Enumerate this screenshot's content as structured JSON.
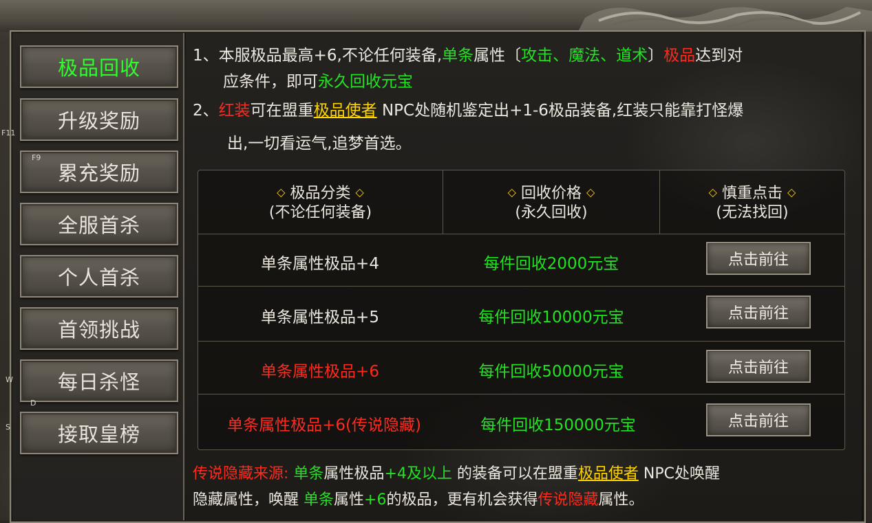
{
  "sidebar": {
    "items": [
      {
        "label": "极品回收"
      },
      {
        "label": "升级奖励"
      },
      {
        "label": "累充奖励"
      },
      {
        "label": "全服首杀"
      },
      {
        "label": "个人首杀"
      },
      {
        "label": "首领挑战"
      },
      {
        "label": "每日杀怪"
      },
      {
        "label": "接取皇榜"
      }
    ],
    "hints": {
      "f11": "F11",
      "f9": "F9",
      "w": "W",
      "d": "D",
      "s": "S"
    }
  },
  "intro": {
    "line1": {
      "p1": "1、本服极品最高+6,不论任何装备,",
      "p2": "单条",
      "p3": "属性〔",
      "p4": "攻击、魔法、道术",
      "p5": "〕",
      "p6": "极品",
      "p7": "达到对"
    },
    "line2": {
      "p1": "应条件，即可",
      "p2": "永久回收元宝"
    },
    "line3": {
      "p1": "2、",
      "p2": "红装",
      "p3": "可在盟重",
      "p4": "极品使者",
      "p5": " NPC处随机鉴定出+1-6极品装备,红装只能靠打怪爆"
    },
    "line4": {
      "p1": "出,一切看运气,追梦首选。"
    }
  },
  "table": {
    "headers": [
      {
        "title": "极品分类",
        "sub": "(不论任何装备)"
      },
      {
        "title": "回收价格",
        "sub": "(永久回收)"
      },
      {
        "title": "慎重点击",
        "sub": "(无法找回)"
      }
    ],
    "diamond": "◇",
    "rows": [
      {
        "name": "单条属性极品+4",
        "price": "每件回收2000元宝",
        "button": "点击前往",
        "highlight": false
      },
      {
        "name": "单条属性极品+5",
        "price": "每件回收10000元宝",
        "button": "点击前往",
        "highlight": false
      },
      {
        "name": "单条属性极品+6",
        "price": "每件回收50000元宝",
        "button": "点击前往",
        "highlight": true
      },
      {
        "name": "单条属性极品+6(传说隐藏)",
        "price": "每件回收150000元宝",
        "button": "点击前往",
        "highlight": true
      }
    ]
  },
  "footer": {
    "line1": {
      "p1": "传说隐藏来源: ",
      "p2": "单条",
      "p3": "属性极品",
      "p4": "+4及以上",
      "p5": " 的装备可以在盟重",
      "p6": "极品使者",
      "p7": " NPC处唤醒"
    },
    "line2": {
      "p1": "隐藏属性，唤醒 ",
      "p2": "单条",
      "p3": "属性",
      "p4": "+6",
      "p5": "的极品，更有机会获得",
      "p6": "传说隐藏",
      "p7": "属性。"
    }
  },
  "colors": {
    "green": "#22e322",
    "red": "#ff2a1e",
    "yellow": "#ffd400",
    "diamond": "#ffcc00"
  }
}
